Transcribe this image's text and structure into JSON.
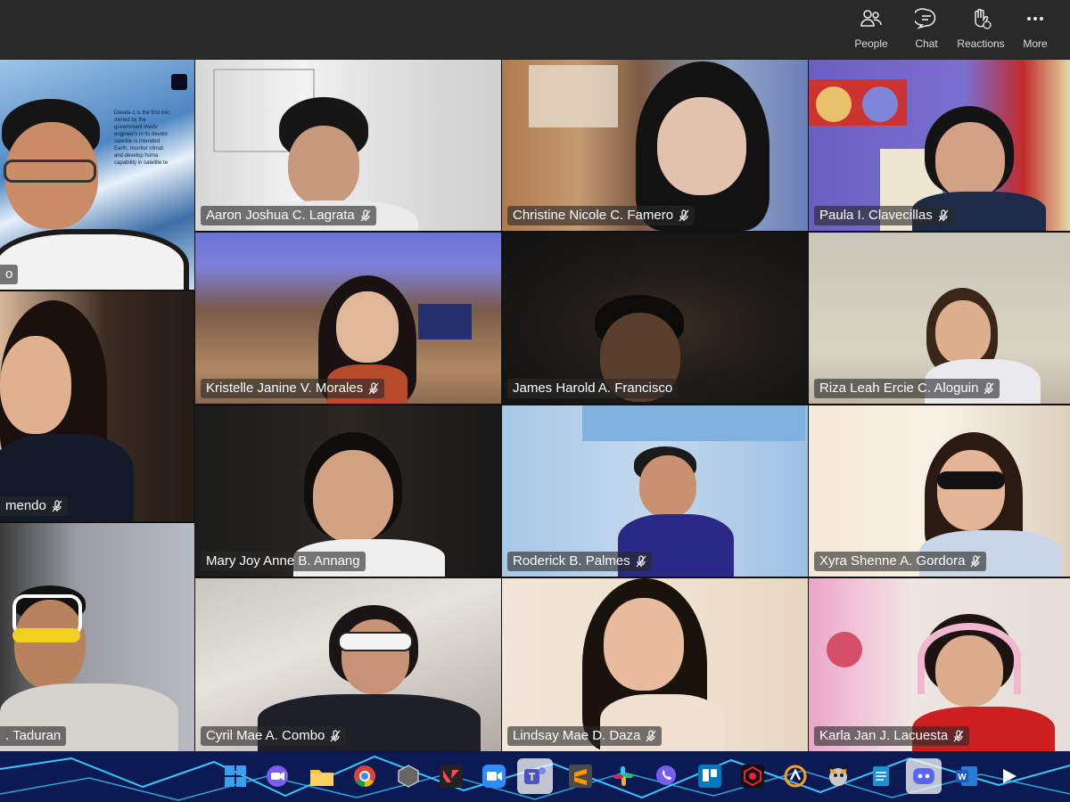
{
  "toolbar": {
    "people_label": "People",
    "chat_label": "Chat",
    "reactions_label": "Reactions",
    "more_label": "More"
  },
  "presentation": {
    "text_lines": [
      "Diwata-1 is the first mic",
      "owned by the",
      "government involv",
      "engineers in its develo",
      "satellite is intended",
      "Earth, monitor climat",
      "and develop huma",
      "capability in satellite te"
    ]
  },
  "participants": [
    {
      "name": "o"
    },
    {
      "name": "Aaron Joshua C. Lagrata"
    },
    {
      "name": "Christine Nicole C. Famero"
    },
    {
      "name": "Paula I. Clavecillas"
    },
    {
      "name": "Kristelle Janine V. Morales"
    },
    {
      "name": "James Harold A. Francisco"
    },
    {
      "name": "Riza Leah Ercie C. Aloguin"
    },
    {
      "name": "mendo"
    },
    {
      "name": "Mary Joy Anne B. Annang"
    },
    {
      "name": "Roderick B. Palmes"
    },
    {
      "name": "Xyra Shenne A. Gordora"
    },
    {
      "name": ". Taduran"
    },
    {
      "name": "Cyril Mae A. Combo"
    },
    {
      "name": "Lindsay Mae D. Daza"
    },
    {
      "name": "Karla Jan J. Lacuesta"
    }
  ],
  "taskbar": {
    "apps": [
      "start-icon",
      "zoom-icon",
      "file-explorer-icon",
      "chrome-icon",
      "unity-icon",
      "valorant-icon",
      "zoom-video-icon",
      "teams-icon",
      "sublime-icon",
      "slack-icon",
      "viber-icon",
      "trello-icon",
      "riot-icon",
      "overwatch-icon",
      "app-icon",
      "notepad-icon",
      "discord-icon",
      "word-icon",
      "media-icon"
    ],
    "colors": {
      "background": "#0b1a52",
      "lines": "#35c8ff"
    }
  }
}
